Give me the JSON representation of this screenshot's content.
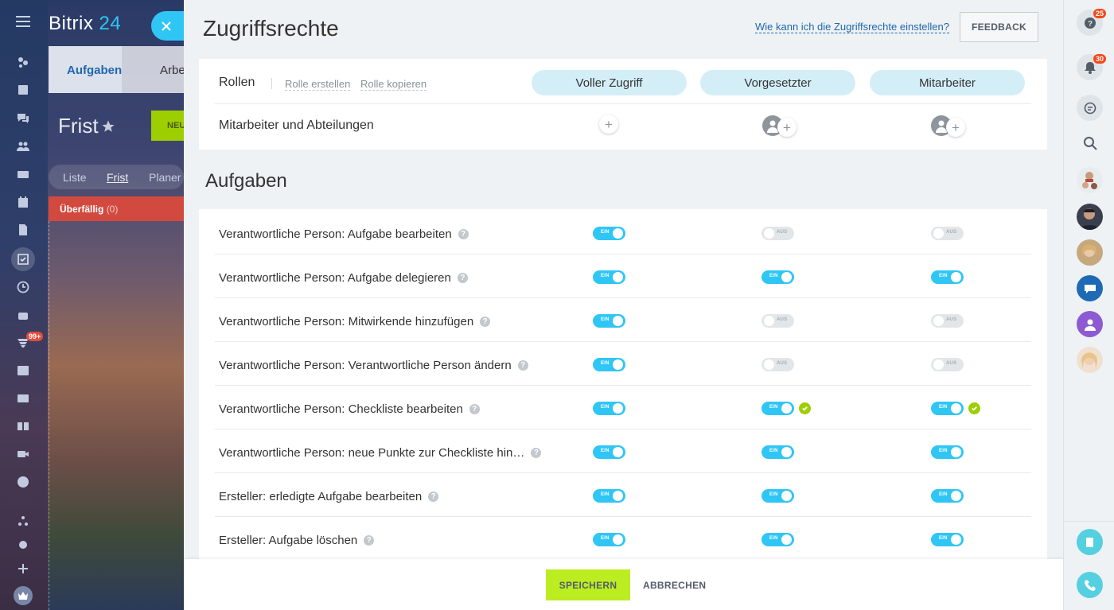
{
  "app": {
    "logo_text": "Bitrix",
    "logo_num": "24",
    "left_badge": "99+"
  },
  "background": {
    "tab_active": "Aufgaben",
    "tab_next": "Arbe",
    "page_title": "Frist",
    "new_button": "NEU",
    "views": [
      "Liste",
      "Frist",
      "Planer"
    ],
    "overdue_label": "Überfällig",
    "overdue_count": "(0)"
  },
  "header": {
    "title": "Zugriffsrechte",
    "help_link": "Wie kann ich die Zugriffsrechte einstellen?",
    "feedback_button": "FEEDBACK"
  },
  "roles": {
    "label": "Rollen",
    "create_link": "Rolle erstellen",
    "copy_link": "Rolle kopieren",
    "columns": [
      "Voller Zugriff",
      "Vorgesetzter",
      "Mitarbeiter"
    ],
    "members_label": "Mitarbeiter und Abteilungen"
  },
  "section": {
    "title": "Aufgaben"
  },
  "toggle_labels": {
    "on": "EIN",
    "off": "AUS"
  },
  "permissions": [
    {
      "label": "Verantwortliche Person: Aufgabe bearbeiten",
      "values": [
        "on",
        "off",
        "off"
      ],
      "checks": [
        false,
        false,
        false
      ]
    },
    {
      "label": "Verantwortliche Person: Aufgabe delegieren",
      "values": [
        "on",
        "on",
        "on"
      ],
      "checks": [
        false,
        false,
        false
      ]
    },
    {
      "label": "Verantwortliche Person: Mitwirkende hinzufügen",
      "values": [
        "on",
        "off",
        "off"
      ],
      "checks": [
        false,
        false,
        false
      ]
    },
    {
      "label": "Verantwortliche Person: Verantwortliche Person ändern",
      "values": [
        "on",
        "off",
        "off"
      ],
      "checks": [
        false,
        false,
        false
      ]
    },
    {
      "label": "Verantwortliche Person: Checkliste bearbeiten",
      "values": [
        "on",
        "on",
        "on"
      ],
      "checks": [
        false,
        true,
        true
      ]
    },
    {
      "label": "Verantwortliche Person: neue Punkte zur Checkliste hin…",
      "values": [
        "on",
        "on",
        "on"
      ],
      "checks": [
        false,
        false,
        false
      ]
    },
    {
      "label": "Ersteller: erledigte Aufgabe bearbeiten",
      "values": [
        "on",
        "on",
        "on"
      ],
      "checks": [
        false,
        false,
        false
      ]
    },
    {
      "label": "Ersteller: Aufgabe löschen",
      "values": [
        "on",
        "on",
        "on"
      ],
      "checks": [
        false,
        false,
        false
      ]
    }
  ],
  "footer": {
    "save_button": "SPEICHERN",
    "cancel_button": "ABBRECHEN"
  },
  "rightbar": {
    "help_badge": "25",
    "notifications_badge": "30"
  },
  "colors": {
    "accent": "#2fc6f6",
    "save": "#bbed21",
    "role_pill": "#d4eef8",
    "check": "#9dcf00",
    "badge": "#f54819"
  }
}
